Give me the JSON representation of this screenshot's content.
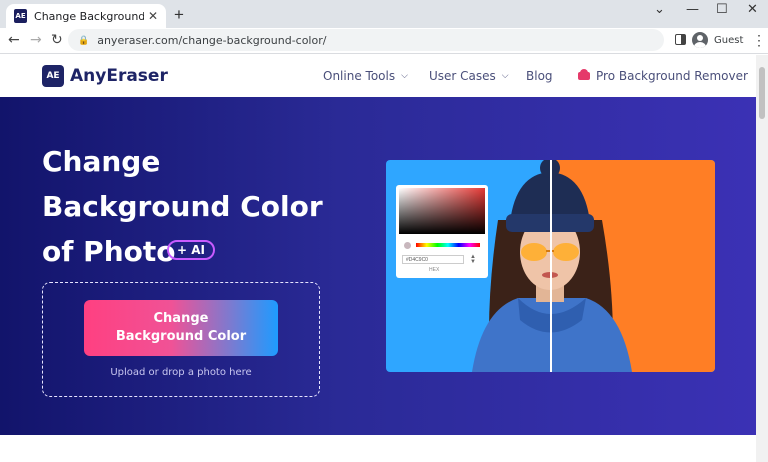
{
  "browser": {
    "tab_title": "Change Background Color Online",
    "favicon_text": "AE",
    "url": "anyeraser.com/change-background-color/",
    "profile_label": "Guest"
  },
  "header": {
    "logo_mark": "AE",
    "logo_text": "AnyEraser",
    "nav": {
      "online_tools": "Online Tools",
      "user_cases": "User Cases",
      "blog": "Blog",
      "pro": "Pro Background Remover"
    }
  },
  "hero": {
    "title_line1": "Change",
    "title_line2": "Background Color",
    "title_line3": "of Photo",
    "ai_badge": "+ AI",
    "cta_line1": "Change",
    "cta_line2": "Background Color",
    "drop_hint": "Upload or drop a photo here"
  },
  "demo": {
    "hex_value": "#D4C9C0",
    "hex_label": "HEX",
    "left_bg_color": "#2fa6ff",
    "right_bg_color": "#ff7e25"
  },
  "colors": {
    "brand": "#1e2466",
    "hero_gradient_start": "#12146b",
    "hero_gradient_end": "#3b31b5",
    "cta_pink": "#ff4081",
    "cta_blue": "#1e9bff"
  }
}
